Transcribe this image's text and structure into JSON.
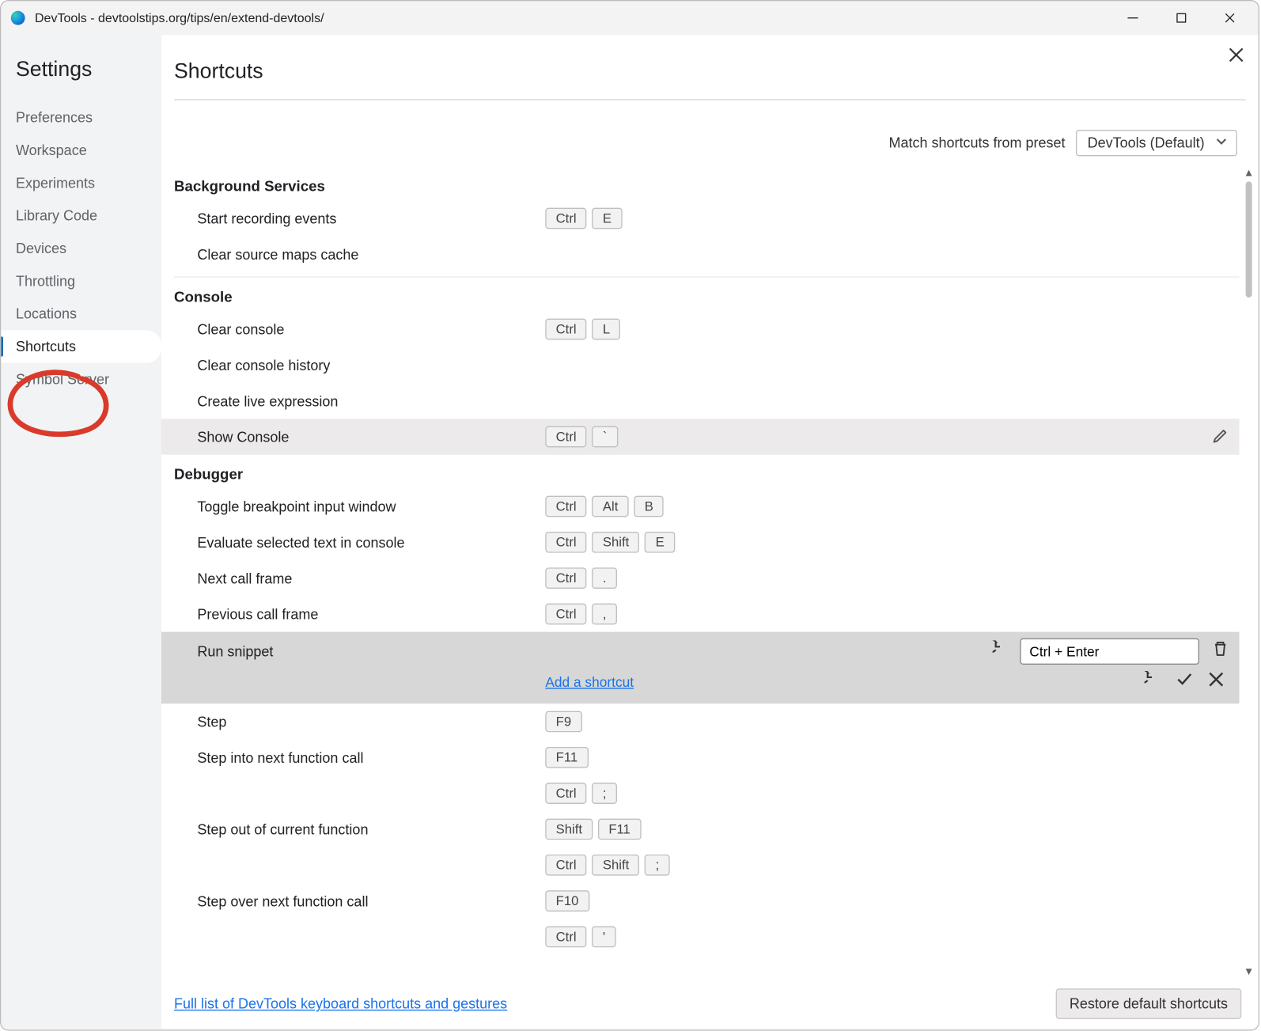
{
  "window": {
    "title": "DevTools - devtoolstips.org/tips/en/extend-devtools/"
  },
  "sidebar": {
    "title": "Settings",
    "items": [
      {
        "label": "Preferences"
      },
      {
        "label": "Workspace"
      },
      {
        "label": "Experiments"
      },
      {
        "label": "Library Code"
      },
      {
        "label": "Devices"
      },
      {
        "label": "Throttling"
      },
      {
        "label": "Locations"
      },
      {
        "label": "Shortcuts"
      },
      {
        "label": "Symbol Server"
      }
    ]
  },
  "page": {
    "title": "Shortcuts"
  },
  "preset": {
    "label": "Match shortcuts from preset",
    "value": "DevTools (Default)"
  },
  "sections": {
    "background": {
      "title": "Background Services",
      "start_recording": {
        "label": "Start recording events",
        "keys": [
          "Ctrl",
          "E"
        ]
      },
      "clear_cache": {
        "label": "Clear source maps cache"
      }
    },
    "console": {
      "title": "Console",
      "clear": {
        "label": "Clear console",
        "keys": [
          "Ctrl",
          "L"
        ]
      },
      "clear_hist": {
        "label": "Clear console history"
      },
      "live_expr": {
        "label": "Create live expression"
      },
      "show": {
        "label": "Show Console",
        "keys": [
          "Ctrl",
          "`"
        ]
      }
    },
    "debugger": {
      "title": "Debugger",
      "toggle_bp": {
        "label": "Toggle breakpoint input window",
        "keys": [
          "Ctrl",
          "Alt",
          "B"
        ]
      },
      "eval_sel": {
        "label": "Evaluate selected text in console",
        "keys": [
          "Ctrl",
          "Shift",
          "E"
        ]
      },
      "next_frame": {
        "label": "Next call frame",
        "keys": [
          "Ctrl",
          "."
        ]
      },
      "prev_frame": {
        "label": "Previous call frame",
        "keys": [
          "Ctrl",
          ","
        ]
      },
      "run_snippet": {
        "label": "Run snippet",
        "input_value": "Ctrl + Enter",
        "add_link": "Add a shortcut"
      },
      "step": {
        "label": "Step",
        "keys": [
          "F9"
        ]
      },
      "step_into": {
        "label": "Step into next function call",
        "keys": [
          "F11"
        ],
        "keys2": [
          "Ctrl",
          ";"
        ]
      },
      "step_out": {
        "label": "Step out of current function",
        "keys": [
          "Shift",
          "F11"
        ],
        "keys2": [
          "Ctrl",
          "Shift",
          ";"
        ]
      },
      "step_over": {
        "label": "Step over next function call",
        "keys": [
          "F10"
        ],
        "keys2": [
          "Ctrl",
          "'"
        ]
      }
    }
  },
  "footer": {
    "link": "Full list of DevTools keyboard shortcuts and gestures",
    "restore": "Restore default shortcuts"
  }
}
